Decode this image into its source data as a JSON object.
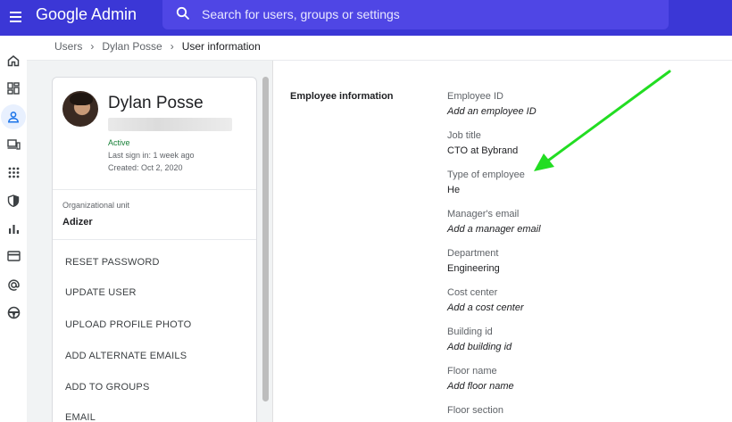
{
  "app": {
    "title": "Google Admin"
  },
  "search": {
    "placeholder": "Search for users, groups or settings"
  },
  "rail": {
    "items": [
      {
        "icon": "home-icon"
      },
      {
        "icon": "dashboard-icon"
      },
      {
        "icon": "user-icon",
        "active": true
      },
      {
        "icon": "devices-icon"
      },
      {
        "icon": "apps-icon"
      },
      {
        "icon": "security-shield-icon"
      },
      {
        "icon": "reports-chart-icon"
      },
      {
        "icon": "billing-card-icon"
      },
      {
        "icon": "at-sign-icon"
      },
      {
        "icon": "support-steering-icon"
      }
    ]
  },
  "breadcrumb": {
    "items": [
      "Users",
      "Dylan Posse",
      "User information"
    ],
    "separator": "›"
  },
  "user": {
    "name": "Dylan Posse",
    "status": "Active",
    "last_sign_in": "Last sign in: 1 week ago",
    "created": "Created: Oct 2, 2020",
    "org_unit_label": "Organizational unit",
    "org_unit_value": "Adizer"
  },
  "actions": [
    "RESET PASSWORD",
    "UPDATE USER",
    "UPLOAD PROFILE PHOTO",
    "ADD ALTERNATE EMAILS",
    "ADD TO GROUPS",
    "EMAIL"
  ],
  "employee": {
    "section_title": "Employee information",
    "fields": [
      {
        "label": "Employee ID",
        "value": "Add an employee ID",
        "is_placeholder": true
      },
      {
        "label": "Job title",
        "value": "CTO at Bybrand",
        "is_placeholder": false
      },
      {
        "label": "Type of employee",
        "value": "He",
        "is_placeholder": false
      },
      {
        "label": "Manager's email",
        "value": "Add a manager email",
        "is_placeholder": true
      },
      {
        "label": "Department",
        "value": "Engineering",
        "is_placeholder": false
      },
      {
        "label": "Cost center",
        "value": "Add a cost center",
        "is_placeholder": true
      },
      {
        "label": "Building id",
        "value": "Add building id",
        "is_placeholder": true
      },
      {
        "label": "Floor name",
        "value": "Add floor name",
        "is_placeholder": true
      },
      {
        "label": "Floor section",
        "value": "",
        "is_placeholder": false
      }
    ]
  },
  "colors": {
    "topbar": "#3b37d6",
    "search": "#4f46e5",
    "active_status": "#188038",
    "annotation_arrow": "#22dd22"
  }
}
